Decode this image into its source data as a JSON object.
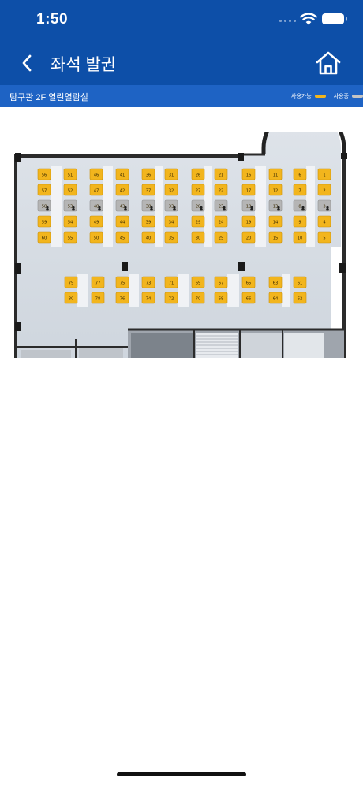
{
  "status_bar": {
    "time": "1:50"
  },
  "header": {
    "title": "좌석 발권",
    "back_icon": "chevron-left-icon",
    "home_icon": "home-icon"
  },
  "room": {
    "name": "탐구관 2F 열린열람실",
    "legend": [
      {
        "label": "사용가능",
        "color": "#f2b51d"
      },
      {
        "label": "사용중",
        "color": "#c4c4c4"
      }
    ]
  },
  "colors": {
    "primary": "#0d4fa8",
    "subbar": "#1e63c4",
    "available": "#f2b51d",
    "occupied": "#b5b5b5"
  },
  "seats": {
    "occupied": [
      58,
      53,
      48,
      43,
      38,
      33,
      28,
      23,
      18,
      13,
      8,
      3
    ],
    "grid_columns": [
      [
        56,
        57,
        58,
        59,
        60
      ],
      [
        51,
        52,
        53,
        54,
        55
      ],
      [
        46,
        47,
        48,
        49,
        50
      ],
      [
        41,
        42,
        43,
        44,
        45
      ],
      [
        36,
        37,
        38,
        39,
        40
      ],
      [
        31,
        32,
        33,
        34,
        35
      ],
      [
        26,
        27,
        28,
        29,
        30
      ],
      [
        21,
        22,
        23,
        24,
        25
      ],
      [
        16,
        17,
        18,
        19,
        20
      ],
      [
        11,
        12,
        13,
        14,
        15
      ],
      [
        6,
        7,
        8,
        9,
        10
      ],
      [
        1,
        2,
        3,
        4,
        5
      ]
    ],
    "lower_columns": [
      [
        79,
        80
      ],
      [
        77,
        78
      ],
      [
        75,
        76
      ],
      [
        73,
        74
      ],
      [
        71,
        72
      ],
      [
        69,
        70
      ],
      [
        67,
        68
      ],
      [
        65,
        66
      ],
      [
        63,
        64
      ],
      [
        61,
        62
      ]
    ]
  }
}
